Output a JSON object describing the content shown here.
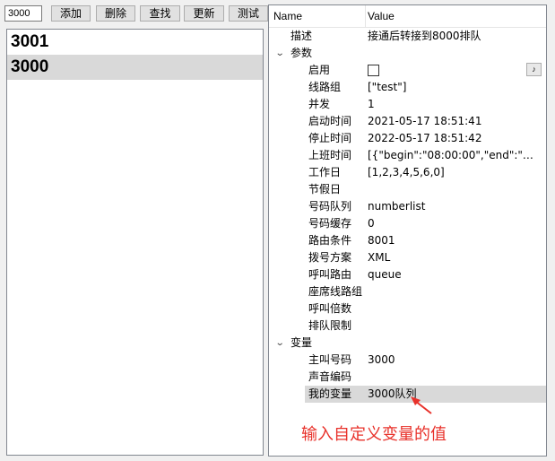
{
  "toolbar": {
    "search_value": "3000",
    "buttons": {
      "add": "添加",
      "delete": "删除",
      "find": "查找",
      "update": "更新",
      "test": "测试"
    }
  },
  "list": {
    "items": [
      "3001",
      "3000"
    ],
    "selected": "3000"
  },
  "grid": {
    "header": {
      "name": "Name",
      "value": "Value"
    },
    "description": {
      "name": "描述",
      "value": "接通后转接到8000排队"
    },
    "params_group": "参数",
    "params": [
      {
        "name": "启用",
        "value": ""
      },
      {
        "name": "线路组",
        "value": "[\"test\"]"
      },
      {
        "name": "并发",
        "value": "1"
      },
      {
        "name": "启动时间",
        "value": "2021-05-17 18:51:41"
      },
      {
        "name": "停止时间",
        "value": "2022-05-17 18:51:42"
      },
      {
        "name": "上班时间",
        "value": "[{\"begin\":\"08:00:00\",\"end\":\"23:0..."
      },
      {
        "name": "工作日",
        "value": "[1,2,3,4,5,6,0]"
      },
      {
        "name": "节假日",
        "value": ""
      },
      {
        "name": "号码队列",
        "value": "numberlist"
      },
      {
        "name": "号码缓存",
        "value": "0"
      },
      {
        "name": "路由条件",
        "value": "8001"
      },
      {
        "name": "拨号方案",
        "value": "XML"
      },
      {
        "name": "呼叫路由",
        "value": "queue"
      },
      {
        "name": "座席线路组",
        "value": ""
      },
      {
        "name": "呼叫倍数",
        "value": ""
      },
      {
        "name": "排队限制",
        "value": ""
      }
    ],
    "vars_group": "变量",
    "vars": [
      {
        "name": "主叫号码",
        "value": "3000"
      },
      {
        "name": "声音编码",
        "value": ""
      },
      {
        "name": "我的变量",
        "value": "3000队列"
      }
    ],
    "enable_checked": false
  },
  "annotation": {
    "text": "输入自定义变量的值",
    "color": "#e8312a"
  }
}
